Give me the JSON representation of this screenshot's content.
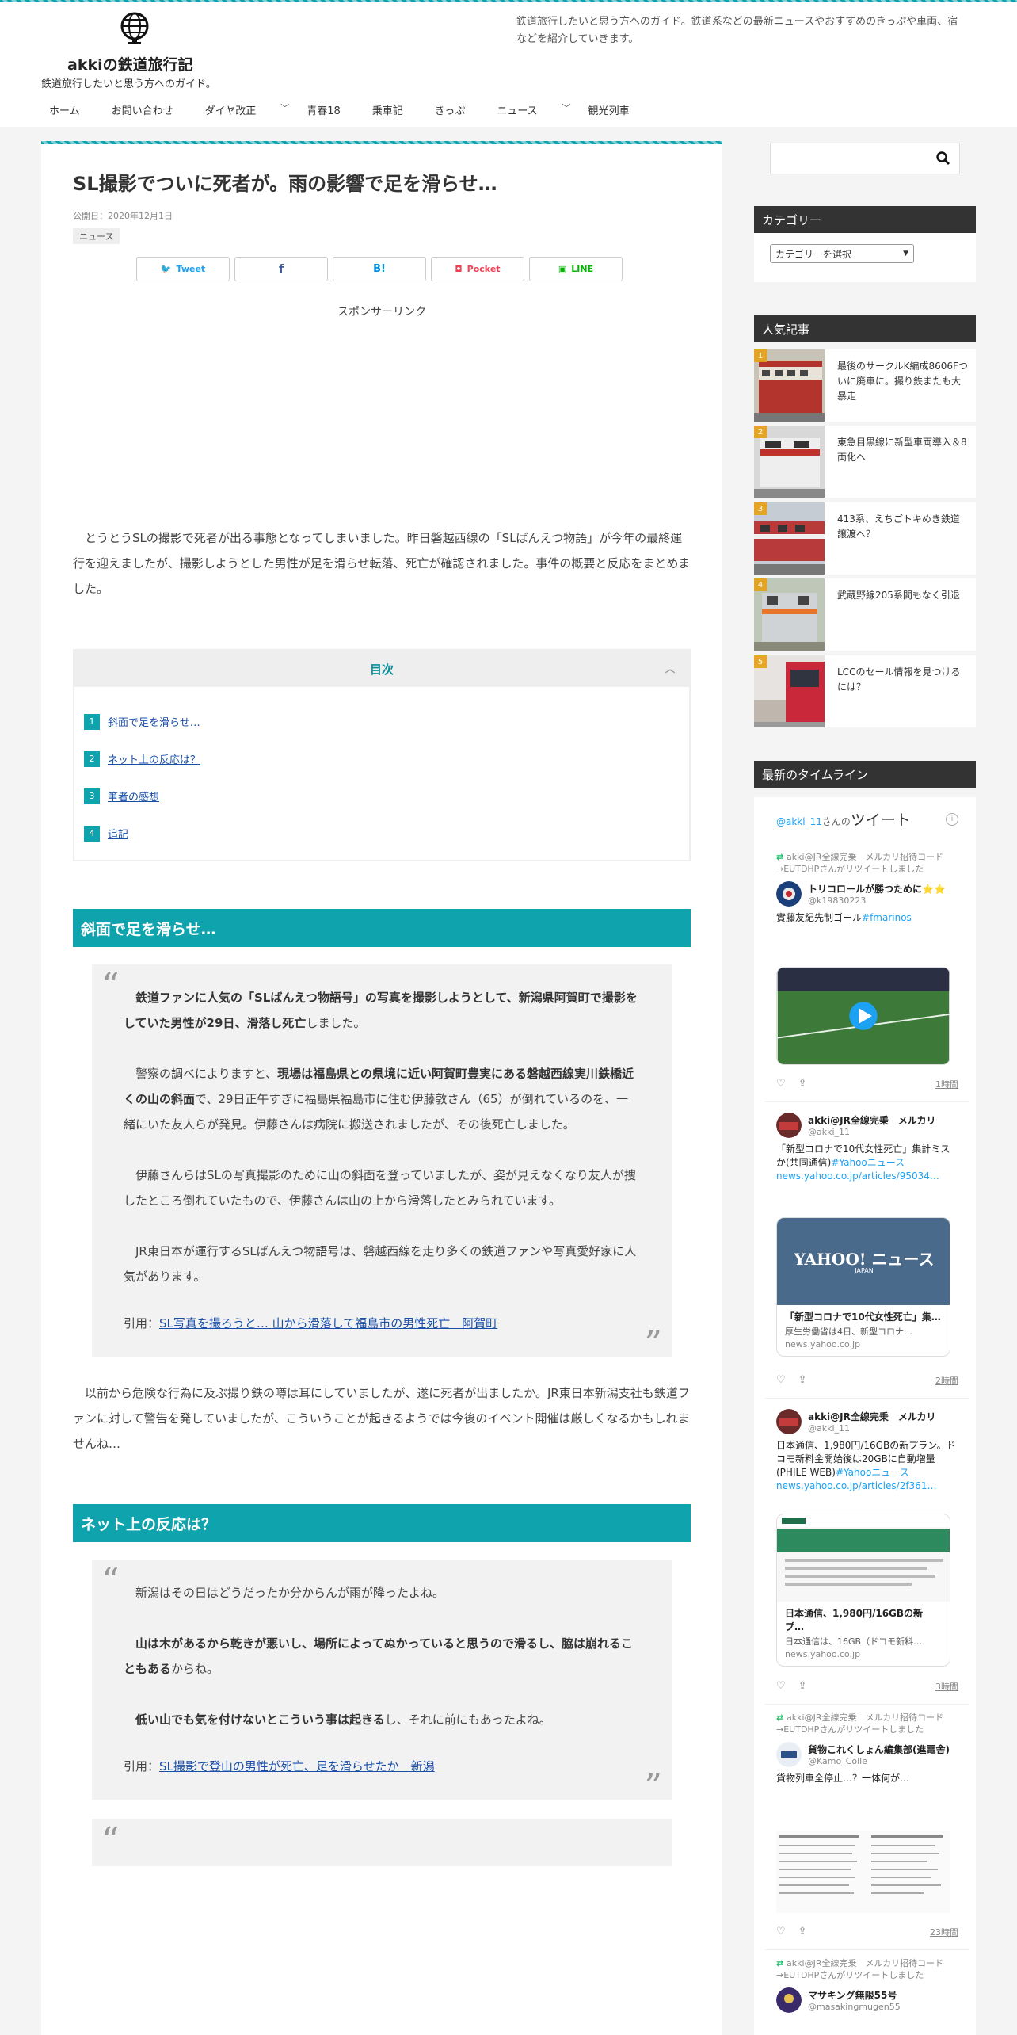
{
  "site": {
    "title": "akkiの鉄道旅行記",
    "tagline": "鉄道旅行したいと思う方へのガイド。",
    "description": "鉄道旅行したいと思う方へのガイド。鉄道系などの最新ニュースやおすすめのきっぷや車両、宿などを紹介していきます。"
  },
  "nav": [
    {
      "label": "ホーム",
      "dropdown": false
    },
    {
      "label": "お問い合わせ",
      "dropdown": false
    },
    {
      "label": "ダイヤ改正",
      "dropdown": true
    },
    {
      "label": "青春18",
      "dropdown": false
    },
    {
      "label": "乗車記",
      "dropdown": false
    },
    {
      "label": "きっぷ",
      "dropdown": false
    },
    {
      "label": "ニュース",
      "dropdown": true
    },
    {
      "label": "観光列車",
      "dropdown": false
    }
  ],
  "article": {
    "title": "SL撮影でついに死者が。雨の影響で足を滑らせ…",
    "published": "公開日：2020年12月1日",
    "category": "ニュース",
    "share": {
      "tweet": "Tweet",
      "facebook": "f",
      "hatena": "B!",
      "pocket": "Pocket",
      "line": "LINE"
    },
    "sponsor": "スポンサーリンク",
    "intro": "とうとうSLの撮影で死者が出る事態となってしまいました。昨日磐越西線の「SLばんえつ物語」が今年の最終運行を迎えましたが、撮影しようとした男性が足を滑らせ転落、死亡が確認されました。事件の概要と反応をまとめました。",
    "toc": {
      "title": "目次",
      "items": [
        {
          "num": "1",
          "label": "斜面で足を滑らせ…"
        },
        {
          "num": "2",
          "label": "ネット上の反応は？"
        },
        {
          "num": "3",
          "label": "筆者の感想"
        },
        {
          "num": "4",
          "label": "追記"
        }
      ]
    },
    "section1": {
      "heading": "斜面で足を滑らせ…",
      "q1_bold": "鉄道ファンに人気の「SLばんえつ物語号」の写真を撮影しようとして、新潟県阿賀町で撮影をしていた男性が29日、滑落し死亡",
      "q1_rest": "しました。",
      "q2_pre": "警察の調べによりますと、",
      "q2_bold": "現場は福島県との県境に近い阿賀町豊実にある磐越西線実川鉄橋近くの山の斜面",
      "q2_rest": "で、29日正午すぎに福島県福島市に住む伊藤敦さん（65）が倒れているのを、一緒にいた友人らが発見。伊藤さんは病院に搬送されましたが、その後死亡しました。",
      "q3": "伊藤さんらはSLの写真撮影のために山の斜面を登っていましたが、姿が見えなくなり友人が捜したところ倒れていたもので、伊藤さんは山の上から滑落したとみられています。",
      "q4": "JR東日本が運行するSLばんえつ物語号は、磐越西線を走り多くの鉄道ファンや写真愛好家に人気があります。",
      "cite_prefix": "引用：",
      "cite_link": "SL写真を撮ろうと… 山から滑落して福島市の男性死亡　阿賀町",
      "after": "以前から危険な行為に及ぶ撮り鉄の噂は耳にしていましたが、遂に死者が出ましたか。JR東日本新潟支社も鉄道ファンに対して警告を発していましたが、こういうことが起きるようでは今後のイベント開催は厳しくなるかもしれませんね…"
    },
    "section2": {
      "heading": "ネット上の反応は？",
      "r1": "新潟はその日はどうだったか分からんが雨が降ったよね。",
      "r2_bold": "山は木があるから乾きが悪いし、場所によってぬかっていると思うので滑るし、脇は崩れることもある",
      "r2_rest": "からね。",
      "r3_bold": "低い山でも気を付けないとこういう事は起きる",
      "r3_rest": "し、それに前にもあったよね。",
      "cite_prefix": "引用：",
      "cite_link": "SL撮影で登山の男性が死亡、足を滑らせたか　新潟"
    }
  },
  "sidebar": {
    "category_title": "カテゴリー",
    "category_select": "カテゴリーを選択",
    "popular_title": "人気記事",
    "popular": [
      {
        "rank": "1",
        "title": "最後のサークルK編成8606Fついに廃車に。撮り鉄またも大暴走"
      },
      {
        "rank": "2",
        "title": "東急目黒線に新型車両導入＆8両化へ"
      },
      {
        "rank": "3",
        "title": "413系、えちごトキめき鉄道譲渡へ？"
      },
      {
        "rank": "4",
        "title": "武蔵野線205系間もなく引退"
      },
      {
        "rank": "5",
        "title": "LCCのセール情報を見つけるには？"
      }
    ],
    "timeline_title": "最新のタイムライン",
    "timeline": {
      "head_user": "@akki_11",
      "head_suffix": "さんの",
      "head_label": "ツイート",
      "rt1": "akki@JR全線完乗　メルカリ招待コード→EUTDHPさんがリツイートしました",
      "t1_name": "トリコロールが勝つために⭐⭐",
      "t1_handle": "@k19830223",
      "t1_text": "實藤友紀先制ゴール",
      "t1_tag": "#fmarinos",
      "t1_time": "1時間",
      "t2_name": "akki@JR全線完乗　メルカリ",
      "t2_handle": "@akki_11",
      "t2_text": "「新型コロナで10代女性死亡」集計ミスか(共同通信)",
      "t2_tag": "#Yahooニュース",
      "t2_link": "news.yahoo.co.jp/articles/95034…",
      "c2_title": "「新型コロナで10代女性死亡」集…",
      "c2_desc": "厚生労働省は4日、新型コロナ…",
      "c2_domain": "news.yahoo.co.jp",
      "c2_logo": "YAHOO! ニュース",
      "c2_logo_sub": "JAPAN",
      "t2_time": "2時間",
      "t3_name": "akki@JR全線完乗　メルカリ",
      "t3_handle": "@akki_11",
      "t3_text": "日本通信、1,980円/16GBの新プラン。ドコモ新料金開始後は20GBに自動増量(PHILE WEB)",
      "t3_tag": "#Yahooニュース",
      "t3_link": "news.yahoo.co.jp/articles/2f361…",
      "c3_title": "日本通信、1,980円/16GBの新プ…",
      "c3_desc": "日本通信は、16GB（ドコモ新料…",
      "c3_domain": "news.yahoo.co.jp",
      "t3_time": "3時間",
      "rt4": "akki@JR全線完乗　メルカリ招待コード→EUTDHPさんがリツイートしました",
      "t4_name": "貨物これくしょん編集部(進電舎)",
      "t4_handle": "@Kamo_Colle",
      "t4_text": "貨物列車全停止…？一体何が…",
      "t4_time": "23時間",
      "rt5": "akki@JR全線完乗　メルカリ招待コード→EUTDHPさんがリツイートしました",
      "t5_name": "マサキング無限55号",
      "t5_handle": "@masakingmugen55"
    }
  },
  "colors": {
    "accent": "#0fa3ad",
    "widget_head": "#333333",
    "link": "#1a4fa8",
    "twitter": "#1da1f2"
  }
}
